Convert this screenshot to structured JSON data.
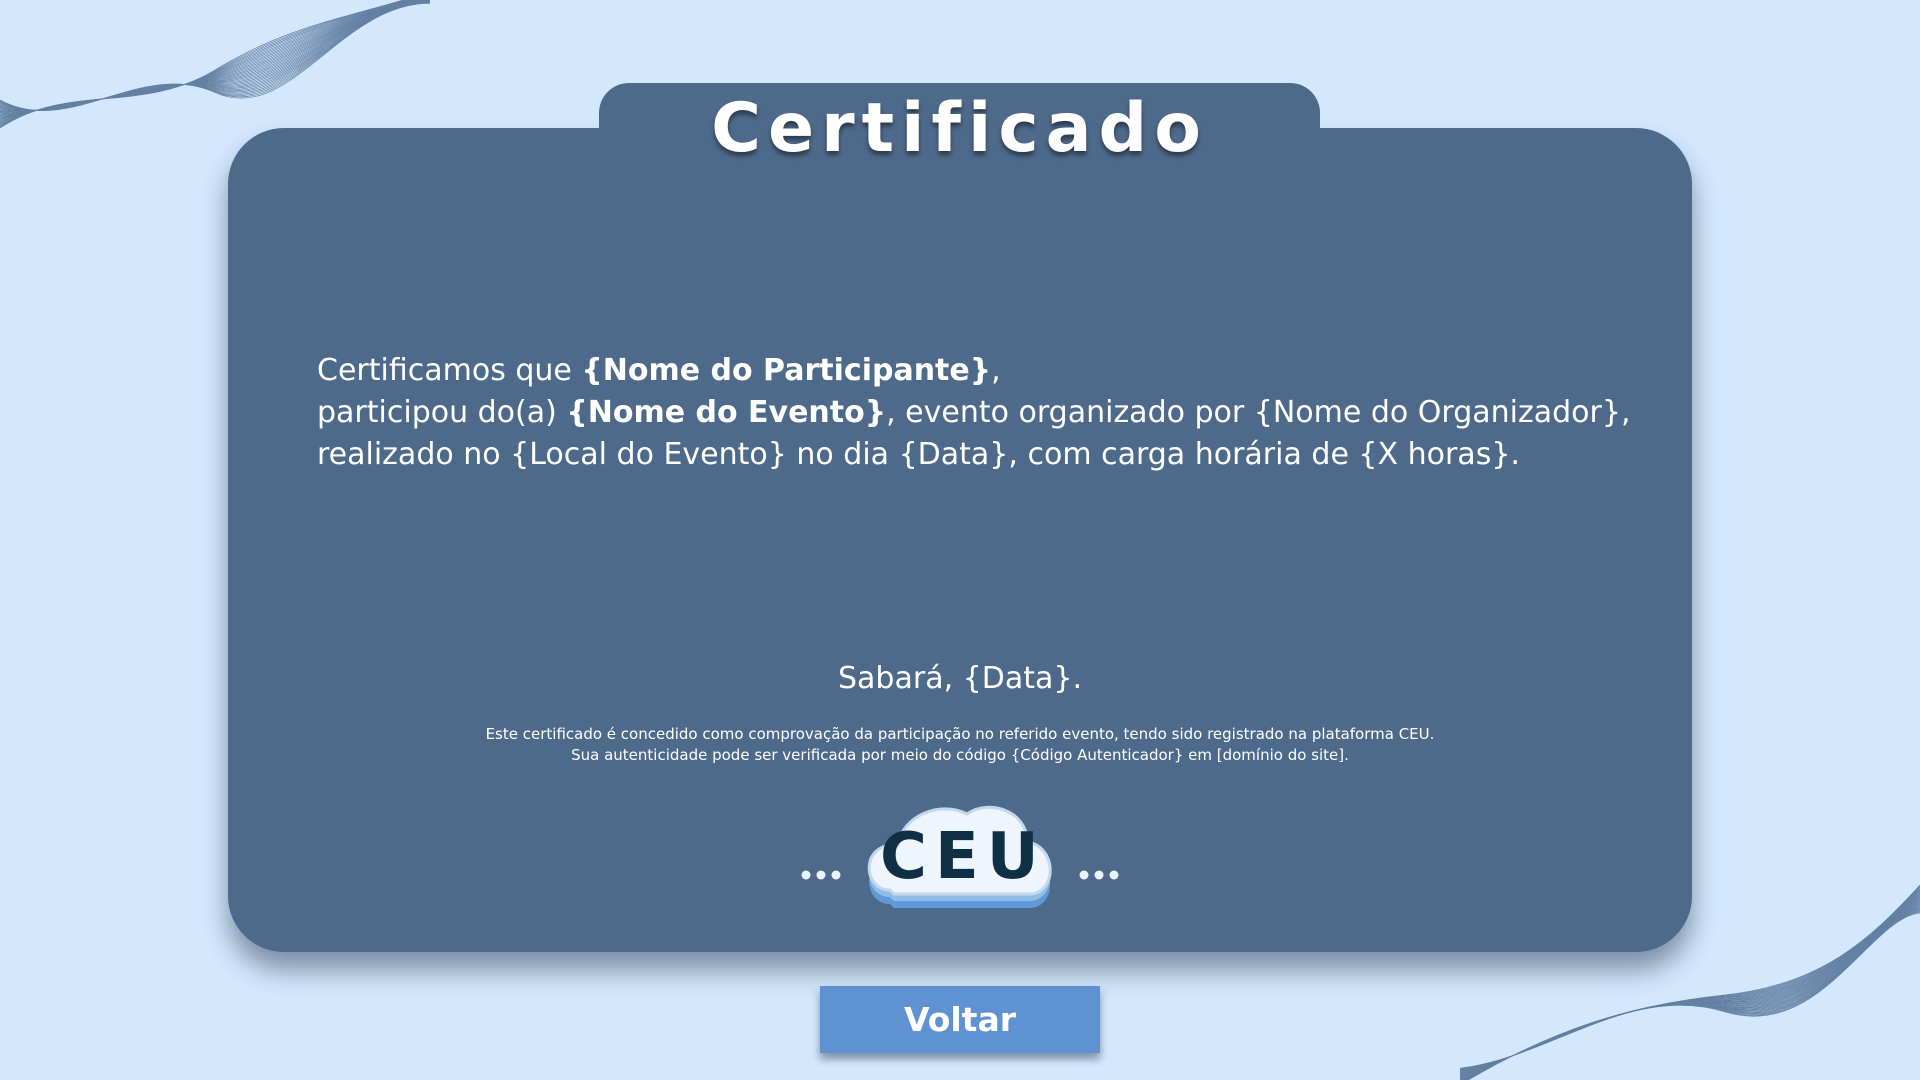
{
  "certificate": {
    "title": "Certificado",
    "line1": {
      "prefix": "Certificamos que ",
      "participant": "{Nome do Participante}",
      "suffix": ","
    },
    "line2": {
      "prefix": "participou do(a) ",
      "event": "{Nome do Evento}",
      "suffix": ", evento organizado por {Nome do Organizador},"
    },
    "line3": "realizado no {Local do Evento} no dia {Data}, com carga horária de {X horas}.",
    "place_date": "Sabará, {Data}.",
    "footnote": [
      "Este certificado é concedido como comprovação da participação no referido evento, tendo sido registrado na plataforma CEU.",
      "Sua autenticidade pode ser verificada por meio do código {Código Autenticador} em [domínio do site]."
    ],
    "logo_text": "CEU"
  },
  "actions": {
    "back_label": "Voltar"
  },
  "colors": {
    "background": "#d3e8fd",
    "card": "#4e6a8b",
    "button": "#5f92d3",
    "logo_text": "#0f2f44",
    "wave": "#3f5f86"
  },
  "icons": {
    "logo": "ceu-cloud-logo",
    "decoration": "wave-lines-decoration"
  }
}
